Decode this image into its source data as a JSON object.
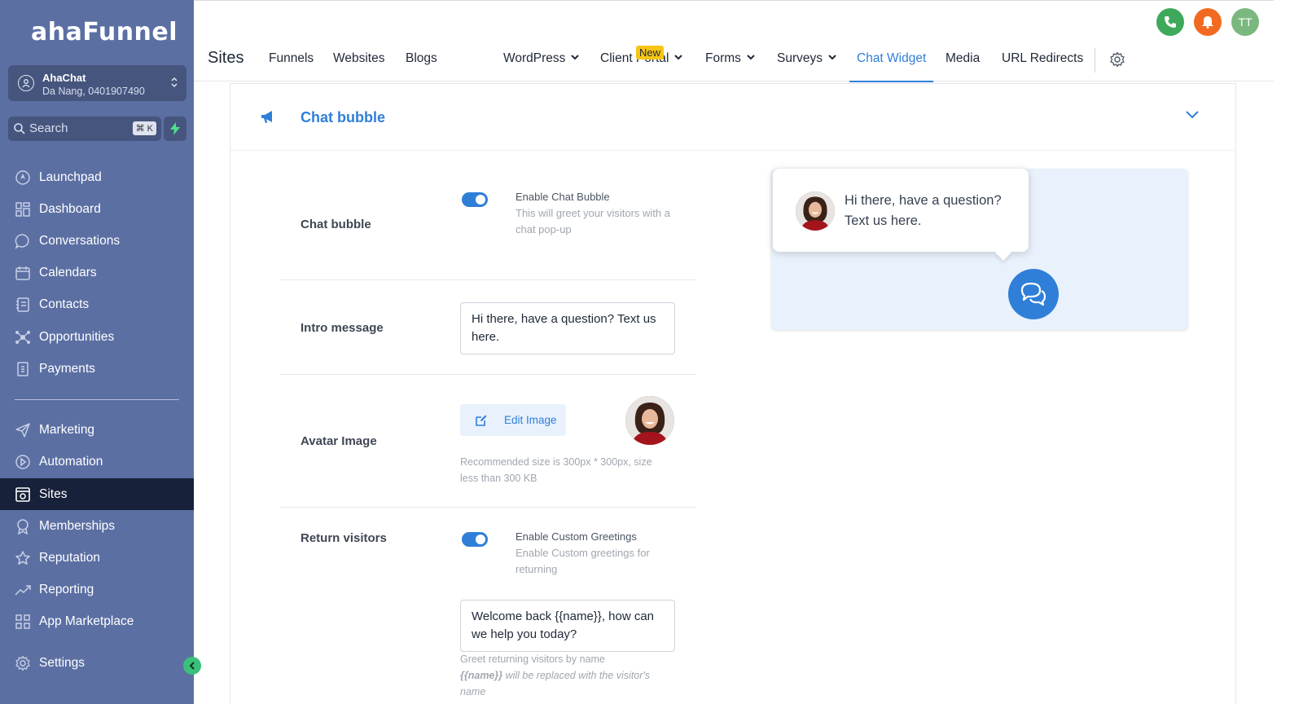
{
  "brand": {
    "logo": "ahaFunnel"
  },
  "account": {
    "name": "AhaChat",
    "location": "Da Nang, 0401907490"
  },
  "search": {
    "label": "Search",
    "shortcut": "⌘ K"
  },
  "sidebar": {
    "items": [
      {
        "label": "Launchpad",
        "icon": "launchpad-icon"
      },
      {
        "label": "Dashboard",
        "icon": "grid-icon"
      },
      {
        "label": "Conversations",
        "icon": "chat-icon"
      },
      {
        "label": "Calendars",
        "icon": "calendar-icon"
      },
      {
        "label": "Contacts",
        "icon": "contacts-icon"
      },
      {
        "label": "Opportunities",
        "icon": "network-icon"
      },
      {
        "label": "Payments",
        "icon": "receipt-icon"
      }
    ],
    "items2": [
      {
        "label": "Marketing",
        "icon": "send-icon"
      },
      {
        "label": "Automation",
        "icon": "automation-icon"
      },
      {
        "label": "Sites",
        "icon": "sites-icon",
        "active": true
      },
      {
        "label": "Memberships",
        "icon": "badge-icon"
      },
      {
        "label": "Reputation",
        "icon": "star-icon"
      },
      {
        "label": "Reporting",
        "icon": "trend-icon"
      },
      {
        "label": "App Marketplace",
        "icon": "apps-icon"
      }
    ],
    "settings": "Settings"
  },
  "header": {
    "title": "Sites",
    "tabs": [
      {
        "label": "Funnels"
      },
      {
        "label": "Websites"
      },
      {
        "label": "Blogs"
      },
      {
        "label": "WordPress"
      },
      {
        "label": "Client Portal"
      },
      {
        "label": "Forms"
      },
      {
        "label": "Surveys"
      },
      {
        "label": "Chat Widget"
      },
      {
        "label": "Media"
      },
      {
        "label": "URL Redirects"
      }
    ],
    "new_badge": "New",
    "user_initials": "TT"
  },
  "panel": {
    "title": "Chat bubble",
    "chat_bubble": {
      "label": "Chat bubble",
      "toggle_title": "Enable Chat Bubble",
      "toggle_desc": "This will greet your visitors with a chat pop-up",
      "enabled": true
    },
    "intro": {
      "label": "Intro message",
      "value": "Hi there, have a question? Text us here."
    },
    "avatar": {
      "label": "Avatar Image",
      "button": "Edit Image",
      "hint": "Recommended size is 300px * 300px, size less than 300 KB"
    },
    "return": {
      "label": "Return visitors",
      "toggle_title": "Enable Custom Greetings",
      "toggle_desc": "Enable Custom greetings for returning",
      "enabled": true,
      "value": "Welcome back {{name}}, how can we help you today?",
      "hint1": "Greet returning visitors by name",
      "hint2_code": "{{name}}",
      "hint2_rest": " will be replaced with the visitor's name"
    }
  },
  "preview": {
    "message": "Hi there, have a question? Text us here."
  }
}
